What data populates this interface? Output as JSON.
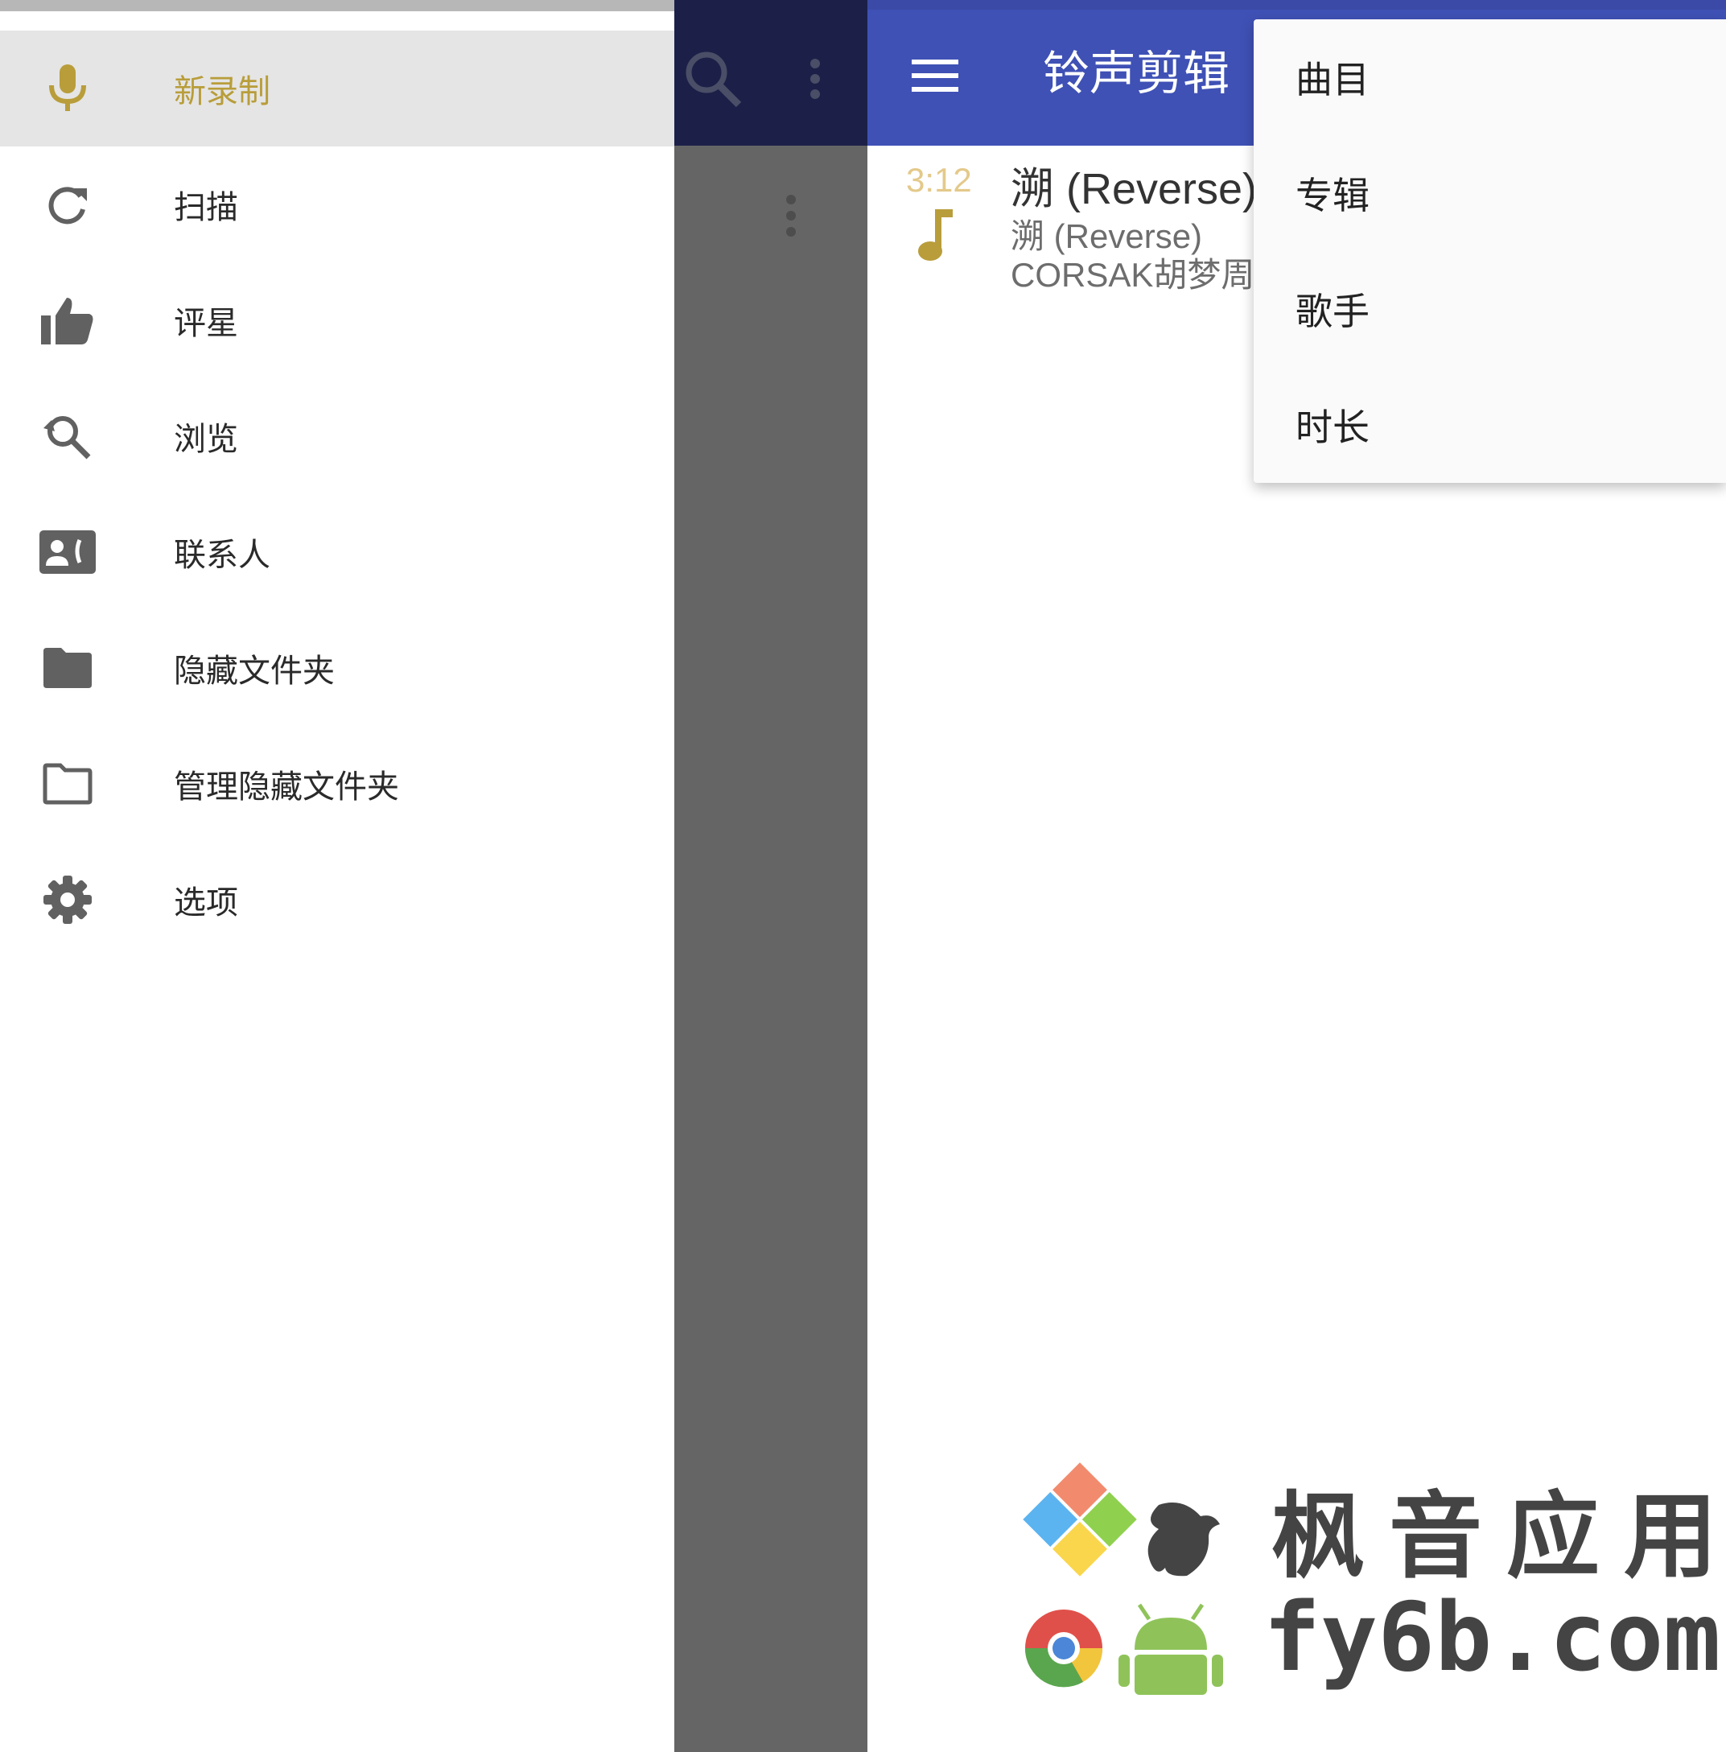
{
  "drawer": {
    "items": [
      {
        "label": "新录制",
        "icon": "mic-icon",
        "active": true
      },
      {
        "label": "扫描",
        "icon": "refresh-icon"
      },
      {
        "label": "评星",
        "icon": "thumb-up-icon"
      },
      {
        "label": "浏览",
        "icon": "search-history-icon"
      },
      {
        "label": "联系人",
        "icon": "contact-card-icon"
      },
      {
        "label": "隐藏文件夹",
        "icon": "folder-filled-icon"
      },
      {
        "label": "管理隐藏文件夹",
        "icon": "folder-outline-icon"
      },
      {
        "label": "选项",
        "icon": "gear-icon"
      }
    ]
  },
  "toolbar": {
    "title": "铃声剪辑",
    "menu_icon": "hamburger-menu-icon",
    "search_icon": "search-icon",
    "more_icon": "more-vert-icon"
  },
  "list": {
    "rows": [
      {
        "duration": "3:12",
        "title": "溯 (Reverse)",
        "album": "溯 (Reverse)",
        "artist": "CORSAK胡梦周",
        "icon": "music-note-icon"
      }
    ]
  },
  "sort_menu": {
    "items": [
      "曲目",
      "专辑",
      "歌手",
      "时长"
    ]
  },
  "watermark": {
    "line1": "枫音应用",
    "line2": "fy6b.com"
  },
  "colors": {
    "toolbar": "#3f51b5",
    "accent": "#b89d3a",
    "dim": "#656565"
  }
}
